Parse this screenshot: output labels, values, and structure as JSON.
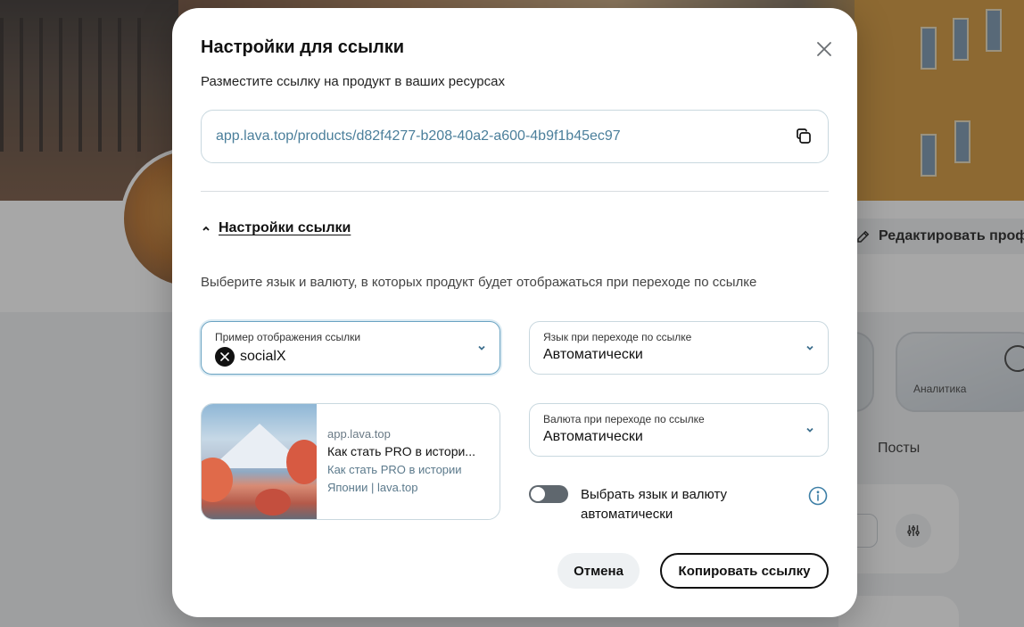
{
  "background": {
    "edit_profile_label": "Редактировать профиль",
    "analytics_label": "Аналитика",
    "tab_posts": "Посты"
  },
  "modal": {
    "title": "Настройки для ссылки",
    "subtitle": "Разместите ссылку на продукт в ваших ресурсах",
    "link_url": "app.lava.top/products/d82f4277-b208-40a2-a600-4b9f1b45ec97",
    "settings_toggle_label": "Настройки ссылки",
    "description": "Выберите язык и валюту, в которых продукт будет отображаться при переходе по ссылке",
    "selects": {
      "display_example": {
        "label": "Пример отображения ссылки",
        "value": "socialX"
      },
      "language": {
        "label": "Язык при переходе по ссылке",
        "value": "Автоматически"
      },
      "currency": {
        "label": "Валюта при переходе по ссылке",
        "value": "Автоматически"
      }
    },
    "preview": {
      "domain": "app.lava.top",
      "title": "Как стать PRO в истори...",
      "description": "Как стать PRO в истории Японии | lava.top"
    },
    "auto_switch": {
      "label": "Выбрать язык и валюту автоматически",
      "checked": false
    },
    "buttons": {
      "cancel": "Отмена",
      "copy": "Копировать ссылку"
    },
    "icons": {
      "close": "close-icon",
      "copy": "copy-icon",
      "chevron": "chevron-down-icon",
      "info": "info-icon",
      "x_logo": "x-logo-icon"
    },
    "colors": {
      "link": "#4b7f9b",
      "info": "#3d7fa6",
      "switch_off": "#5f676e"
    }
  }
}
